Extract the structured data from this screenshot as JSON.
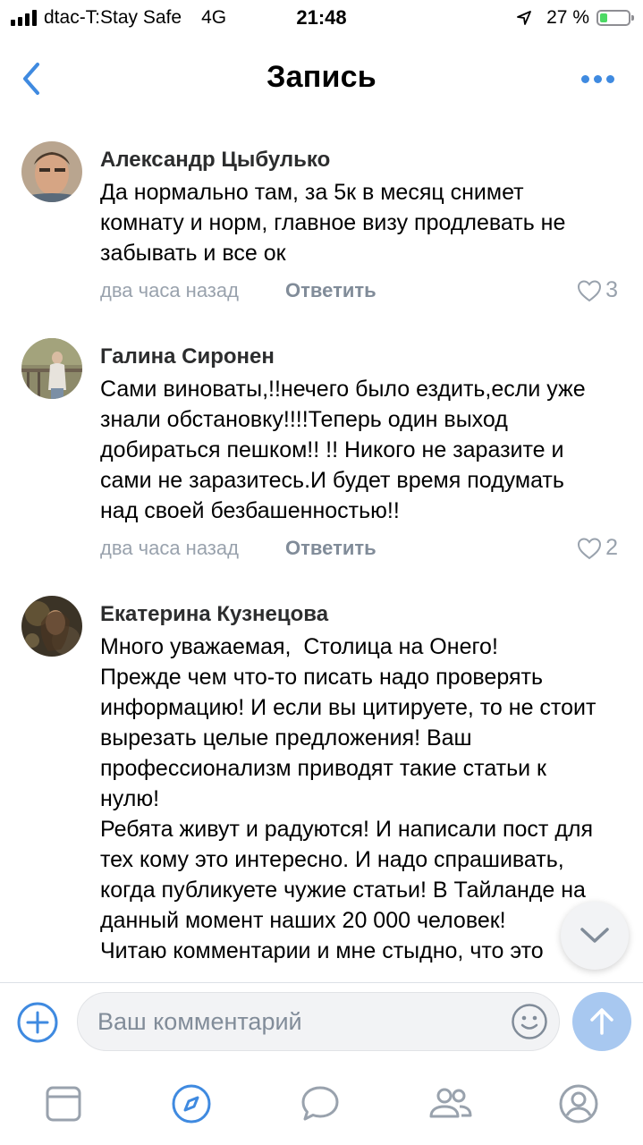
{
  "status_bar": {
    "carrier": "dtac-T:Stay Safe",
    "network": "4G",
    "time": "21:48",
    "battery_percent": "27 %",
    "battery_level": 0.27,
    "signal_bars": 4
  },
  "nav": {
    "title": "Запись",
    "back_icon": "chevron-left-icon",
    "more_icon": "more-dots-icon",
    "accent_color": "#3f8ae0"
  },
  "comments": [
    {
      "author": "Александр Цыбулько",
      "text": "Да нормально там, за 5к в месяц снимет комнату и норм, главное визу продлевать не забывать и все ок",
      "time": "два часа назад",
      "reply_label": "Ответить",
      "likes": "3"
    },
    {
      "author": "Галина Сиронен",
      "text": "Сами виноваты,!!нечего было ездить,если уже знали обстановку!!!!Теперь один выход добираться пешком!! !! Никого не заразите и сами не заразитесь.И будет время подумать над своей безбашенностью!!",
      "time": "два часа назад",
      "reply_label": "Ответить",
      "likes": "2"
    },
    {
      "author": "Екатерина Кузнецова",
      "text": "Много уважаемая,  Столица на Онего!\nПрежде чем что-то писать надо проверять информацию! И если вы цитируете, то не стоит вырезать целые предложения! Ваш профессионализм приводят такие статьи к нулю!\nРебята живут и радуются! И написали пост для тех кому это интересно. И надо спрашивать, когда публикуете чужие статьи! В Тайланде на данный момент наших 20 000 человек!\nЧитаю комментарии и мне стыдно, что это"
    }
  ],
  "composer": {
    "placeholder": "Ваш комментарий"
  },
  "tabs": [
    "news-icon",
    "discover-icon",
    "messages-icon",
    "friends-icon",
    "profile-icon"
  ]
}
